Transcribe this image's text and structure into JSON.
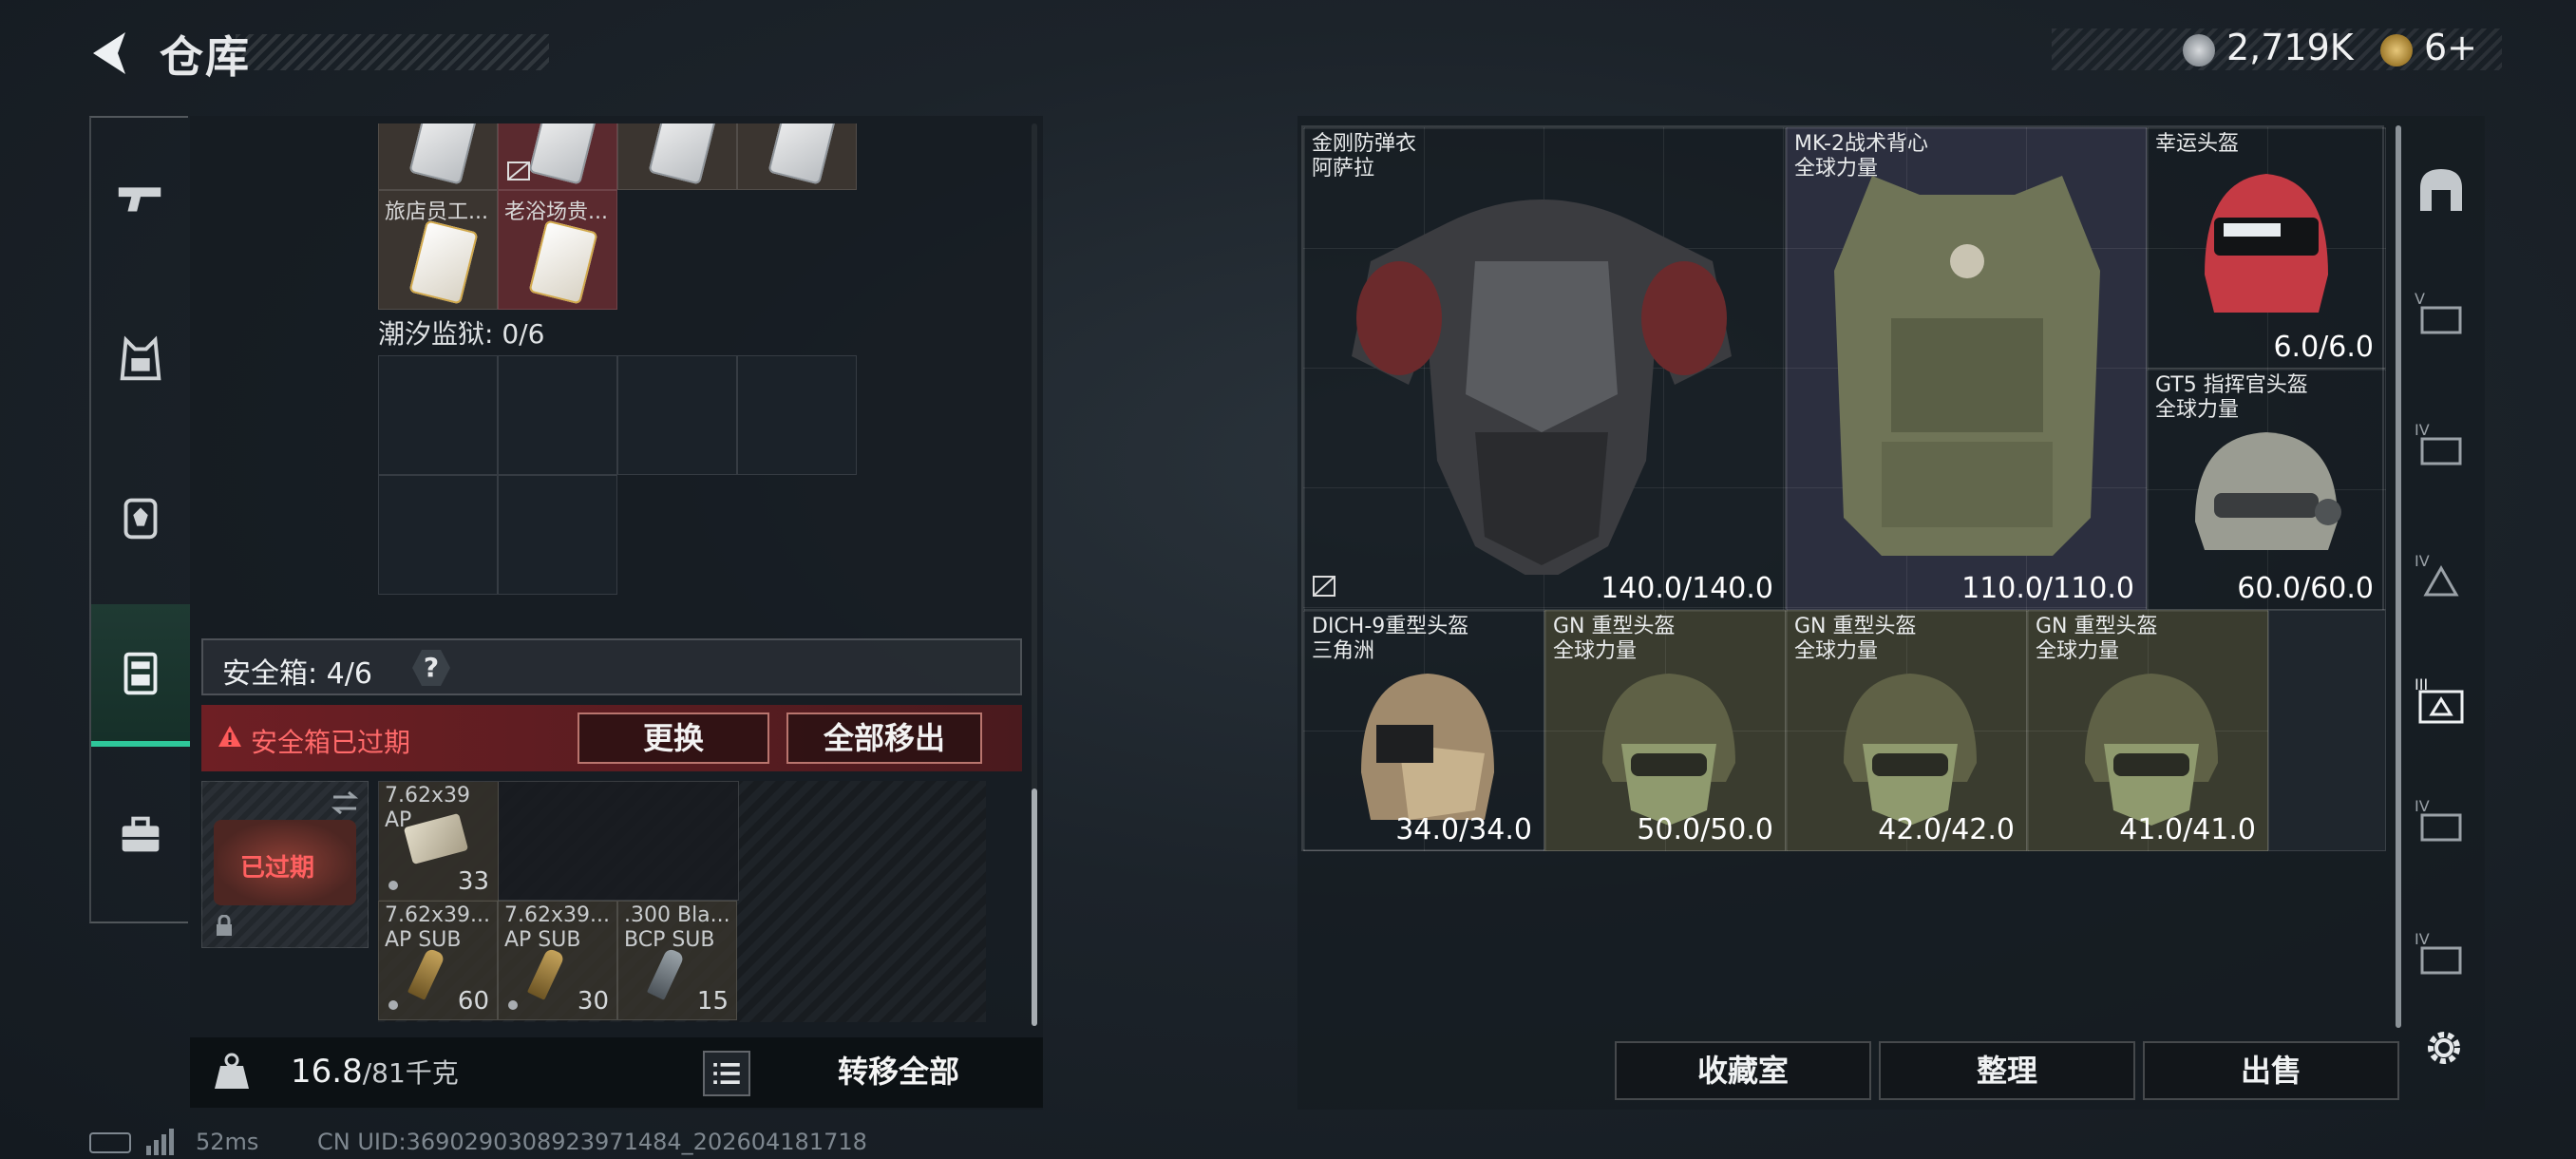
{
  "header": {
    "title": "仓库",
    "currency_amount": "2,719K",
    "tickets": "6+"
  },
  "left": {
    "top_items": [
      {
        "label": ""
      },
      {
        "label": ""
      },
      {
        "label": ""
      },
      {
        "label": ""
      },
      {
        "label": "旅店员工..."
      },
      {
        "label": "老浴场贵..."
      }
    ],
    "prison_label": "潮汐监狱: 0/6",
    "safebox_label": "安全箱: 4/6",
    "help": "?",
    "expired_text": "安全箱已过期",
    "replace_button": "更换",
    "move_all_out_button": "全部移出",
    "safe_thumb_text": "已过期",
    "ammo": [
      {
        "name": "7.62x39\nAP",
        "count": "33"
      },
      {
        "name": "7.62x39...\nAP SUB",
        "count": "60"
      },
      {
        "name": "7.62x39...\nAP SUB",
        "count": "30"
      },
      {
        "name": ".300 Bla...\nBCP SUB",
        "count": "15"
      }
    ],
    "weight_current": "16.8",
    "weight_max": "/81千克",
    "transfer_all": "转移全部"
  },
  "status": {
    "ping": "52ms",
    "uid": "CN UID:3690290308923971484_202604181718"
  },
  "equipment": [
    {
      "name": "金刚防弹衣\n阿萨拉",
      "durability": "140.0/140.0"
    },
    {
      "name": "MK-2战术背心\n全球力量",
      "durability": "110.0/110.0"
    },
    {
      "name": "幸运头盔",
      "durability": "6.0/6.0"
    },
    {
      "name": "GT5 指挥官头盔\n全球力量",
      "durability": "60.0/60.0"
    },
    {
      "name": "DICH-9重型头盔\n三角洲",
      "durability": "34.0/34.0"
    },
    {
      "name": "GN 重型头盔\n全球力量",
      "durability": "50.0/50.0"
    },
    {
      "name": "GN 重型头盔\n全球力量",
      "durability": "42.0/42.0"
    },
    {
      "name": "GN 重型头盔\n全球力量",
      "durability": "41.0/41.0"
    }
  ],
  "footer": {
    "collection_button": "收藏室",
    "sort_button": "整理",
    "sell_button": "出售"
  },
  "colors": {
    "accent": "#2ec79a",
    "danger": "#ff6a6a",
    "slot_red": "#5e2a31",
    "slot_olive": "#3a3c2f",
    "slot_navy": "#2c2f3f"
  }
}
